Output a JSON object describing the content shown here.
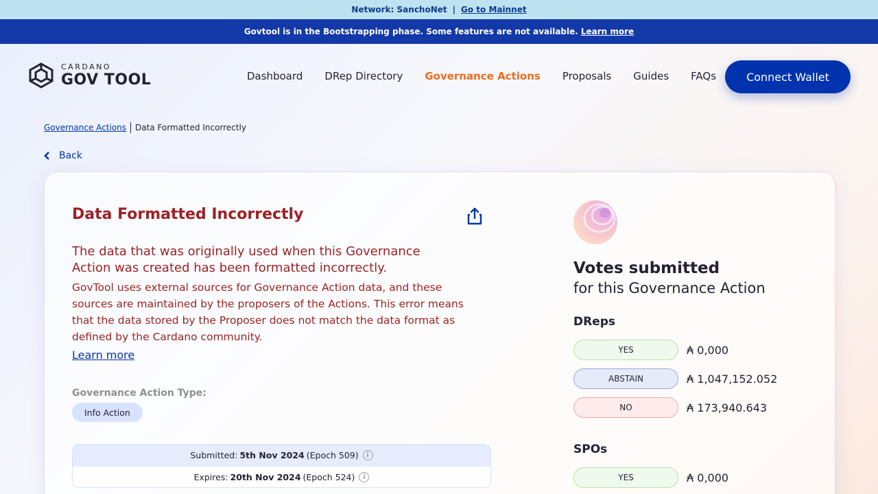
{
  "network_bar": {
    "network_label": "Network: SanchoNet",
    "separator": "|",
    "mainnet_link": "Go to Mainnet"
  },
  "bootstrap_bar": {
    "message": "Govtool is in the Bootstrapping phase. Some features are not available.",
    "link": "Learn more"
  },
  "logo": {
    "line1": "CARDANO",
    "line2": "GOV TOOL"
  },
  "nav": {
    "items": [
      {
        "label": "Dashboard",
        "active": false
      },
      {
        "label": "DRep Directory",
        "active": false
      },
      {
        "label": "Governance Actions",
        "active": true
      },
      {
        "label": "Proposals",
        "active": false
      },
      {
        "label": "Guides",
        "active": false
      },
      {
        "label": "FAQs",
        "active": false
      }
    ],
    "connect_label": "Connect Wallet"
  },
  "breadcrumb": {
    "parent": "Governance Actions",
    "current": "Data Formatted Incorrectly"
  },
  "back_label": "Back",
  "action": {
    "title": "Data Formatted Incorrectly",
    "error_heading": "The data that was originally used when this Governance Action was created has been formatted incorrectly.",
    "error_body": "GovTool uses external sources for Governance Action data, and these sources are maintained by the proposers of the Actions. This error means that the data stored by the Proposer does not match the data format as defined by the Cardano community.",
    "learn_more": "Learn more",
    "type_label": "Governance Action Type:",
    "type_value": "Info Action",
    "submitted": {
      "label": "Submitted:",
      "date": "5th Nov 2024",
      "epoch": "(Epoch 509)"
    },
    "expires": {
      "label": "Expires:",
      "date": "20th Nov 2024",
      "epoch": "(Epoch 524)"
    },
    "info_glyph": "i"
  },
  "votes": {
    "title": "Votes submitted",
    "subtitle": "for this Governance Action",
    "dreps": {
      "label": "DReps",
      "rows": [
        {
          "choice": "YES",
          "amount": "₳ 0,000"
        },
        {
          "choice": "ABSTAIN",
          "amount": "₳ 1,047,152.052"
        },
        {
          "choice": "NO",
          "amount": "₳ 173,940.643"
        }
      ]
    },
    "spos": {
      "label": "SPOs",
      "rows": [
        {
          "choice": "YES",
          "amount": "₳ 0,000"
        }
      ]
    }
  },
  "colors": {
    "accent": "#0033ad",
    "active_nav": "#f06b1e",
    "error": "#9c2224",
    "bootstrap_bar": "#1339a8",
    "network_bar": "#bde3f0"
  },
  "icons": {
    "logo": "cardano-hex-logo-icon",
    "share": "share-icon",
    "back": "chevron-left-icon",
    "info": "info-icon",
    "orb": "votes-orb-icon"
  }
}
